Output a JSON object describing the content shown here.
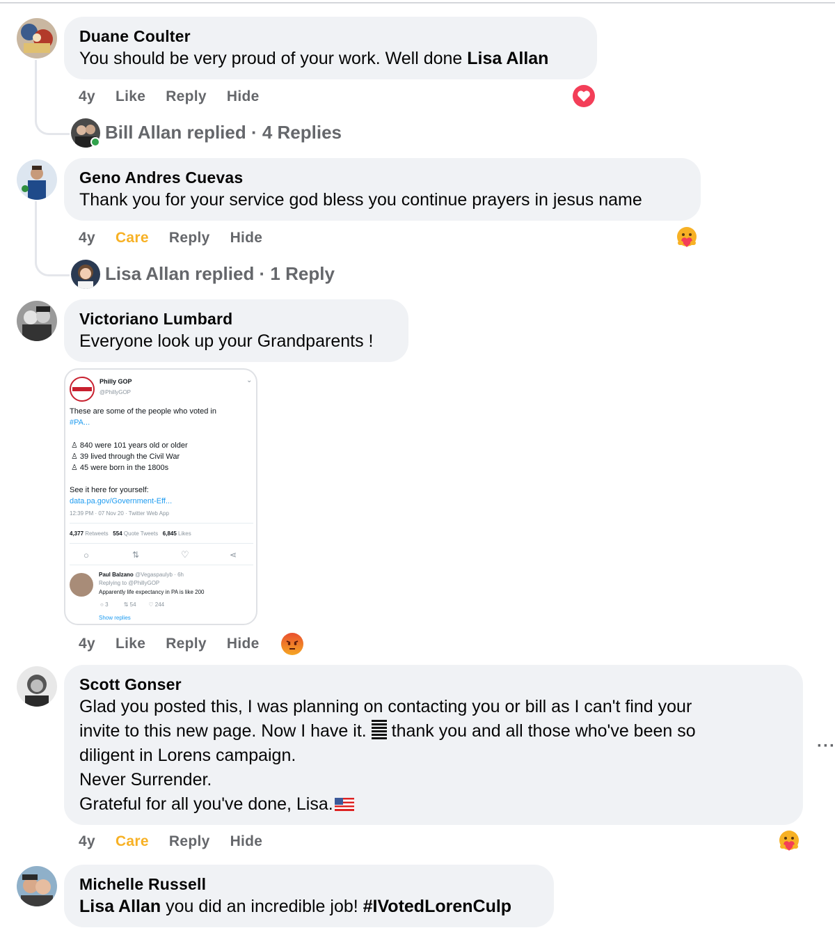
{
  "comments": [
    {
      "author": "Duane Coulter",
      "text_before": "You should be very proud of your work. Well done ",
      "text_bold": "Lisa Allan",
      "time": "4y",
      "action1": "Like",
      "reply": "Reply",
      "hide": "Hide",
      "reaction": "love",
      "replied_summary": "Bill Allan replied · 4 Replies"
    },
    {
      "author": "Geno Andres Cuevas",
      "text": "Thank you for your service god bless you continue prayers in jesus name",
      "time": "4y",
      "action1": "Care",
      "reply": "Reply",
      "hide": "Hide",
      "reaction": "care",
      "replied_summary": "Lisa Allan replied · 1 Reply"
    },
    {
      "author": "Victoriano Lumbard",
      "text": "Everyone look up your Grandparents !",
      "time": "4y",
      "action1": "Like",
      "reply": "Reply",
      "hide": "Hide",
      "reaction": "angry",
      "attachment": {
        "account_name": "Philly GOP",
        "handle": "@PhillyGOP",
        "line1": "These are some of the people who voted in",
        "hashtag": "#PA...",
        "stat1": "840 were 101 years old or older",
        "stat2": "39 lived through the Civil War",
        "stat3": "45 were born in the 1800s",
        "see": "See it here for yourself:",
        "link": "data.pa.gov/Government-Eff...",
        "timestamp": "12:39 PM · 07 Nov 20 · Twitter Web App",
        "retweets": "4,377",
        "retweets_label": "Retweets",
        "quotes": "554",
        "quotes_label": "Quote Tweets",
        "likes": "6,845",
        "likes_label": "Likes",
        "reply_author": "Paul Balzano",
        "reply_handle": "@Vegaspaulyb · 6h",
        "replying_to": "Replying to @PhillyGOP",
        "reply_text": "Apparently life expectancy in PA is like 200",
        "reply_replies": "3",
        "reply_retweets": "54",
        "reply_likes": "244",
        "show_replies": "Show replies"
      }
    },
    {
      "author": "Scott Gonser",
      "line1": "Glad you posted this, I was planning on contacting you or bill as I can't find your",
      "line2a": "invite to this new page. Now I have it. ",
      "line2b": " thank you and all those who've been so",
      "line3": "diligent in Lorens campaign.",
      "line4": "Never Surrender.",
      "line5": "Grateful for all you've done, Lisa.",
      "time": "4y",
      "action1": "Care",
      "reply": "Reply",
      "hide": "Hide",
      "reaction": "care",
      "more": "···"
    },
    {
      "author": "Michelle Russell",
      "text_bold": "Lisa Allan",
      "text_mid": " you did an incredible job! ",
      "hashtag": "#IVotedLorenCulp"
    }
  ],
  "colors": {
    "bubble": "#f0f2f5",
    "meta": "#65676b",
    "care": "#f7b125",
    "love": "#f33e58",
    "online": "#31a24c"
  }
}
